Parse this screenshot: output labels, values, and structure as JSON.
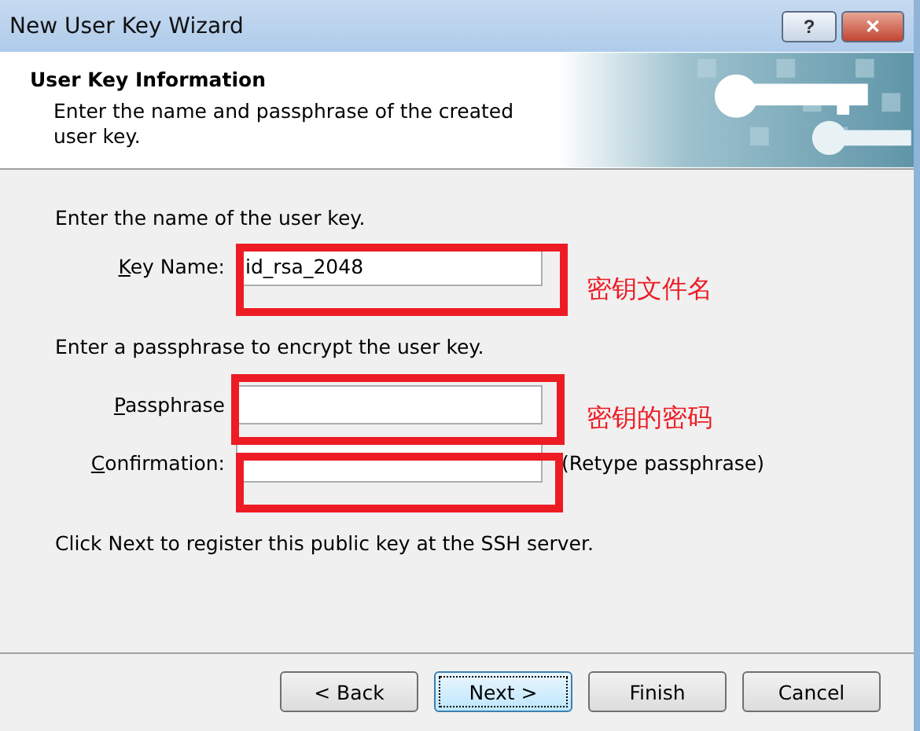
{
  "window": {
    "title": "New User Key Wizard",
    "controls": [
      {
        "kind": "help",
        "label": "?"
      },
      {
        "kind": "close",
        "label": "✕"
      }
    ]
  },
  "header": {
    "title": "User Key Information",
    "subtitle": "Enter the name and passphrase of the created user key."
  },
  "name_section": {
    "prompt": "Enter the name of the user key.",
    "field": {
      "label": "Key Name:",
      "mnemonic": true,
      "value": "id_rsa_2048"
    }
  },
  "passphrase_section": {
    "prompt": "Enter a passphrase to encrypt the user key.",
    "fields": [
      {
        "label": "Passphrase",
        "mnemonic": true
      },
      {
        "label": "Confirmation:",
        "mnemonic": true,
        "hint": "(Retype passphrase)"
      }
    ]
  },
  "footer_note": "Click Next to register this public key at the SSH server.",
  "buttons": [
    {
      "label": "< Back",
      "default": false
    },
    {
      "label": "Next >",
      "default": true
    },
    {
      "label": "Finish",
      "default": false
    },
    {
      "label": "Cancel",
      "default": false
    }
  ],
  "annotations": [
    {
      "kind": "frame",
      "note": "密钥文件名"
    },
    {
      "kind": "frame",
      "note": "密钥的密码"
    },
    {
      "kind": "frame"
    }
  ]
}
